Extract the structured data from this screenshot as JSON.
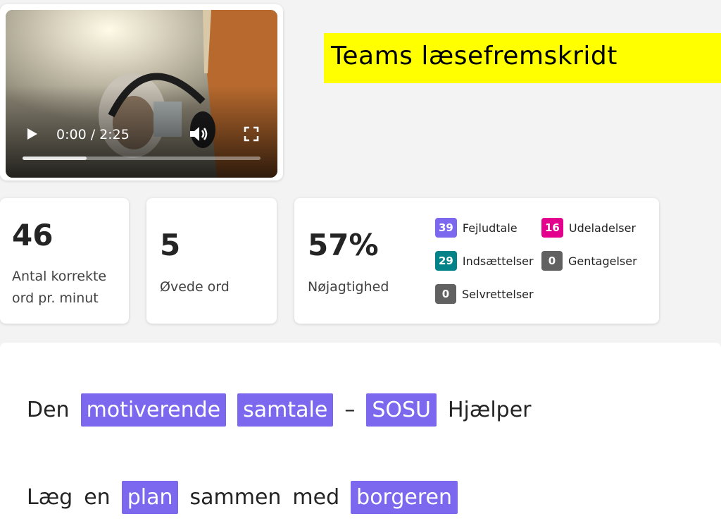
{
  "video": {
    "time_display": "0:00 / 2:25",
    "progress": 0.27,
    "icons": [
      "play-icon",
      "volume-icon",
      "fullscreen-icon"
    ]
  },
  "title": "Teams læsefremskridt",
  "stats": {
    "wcpm": {
      "value": "46",
      "label_line1": "Antal korrekte",
      "label_line2": "ord pr. minut"
    },
    "practiced": {
      "value": "5",
      "label": "Øvede ord"
    },
    "accuracy": {
      "value": "57%",
      "label": "Nøjagtighed"
    }
  },
  "errors": {
    "mispronunciation": {
      "count": "39",
      "label": "Fejludtale",
      "color": "#7b68ee"
    },
    "omissions": {
      "count": "16",
      "label": "Udeladelser",
      "color": "#e3008c"
    },
    "insertions": {
      "count": "29",
      "label": "Indsættelser",
      "color": "#038387"
    },
    "repetitions": {
      "count": "0",
      "label": "Gentagelser",
      "color": "#616161"
    },
    "self_corrections": {
      "count": "0",
      "label": "Selvrettelser",
      "color": "#616161"
    }
  },
  "passage": {
    "line1": [
      {
        "text": "Den",
        "highlight": false
      },
      {
        "text": "motiverende",
        "highlight": true
      },
      {
        "text": "samtale",
        "highlight": true
      },
      {
        "text": "–",
        "highlight": false
      },
      {
        "text": "SOSU",
        "highlight": true
      },
      {
        "text": "Hjælper",
        "highlight": false
      }
    ],
    "line2": [
      {
        "text": "Læg",
        "highlight": false
      },
      {
        "text": "en",
        "highlight": false
      },
      {
        "text": "plan",
        "highlight": true
      },
      {
        "text": "sammen",
        "highlight": false
      },
      {
        "text": "med",
        "highlight": false
      },
      {
        "text": "borgeren",
        "highlight": true
      }
    ],
    "highlight_color": "#7b68ee"
  }
}
